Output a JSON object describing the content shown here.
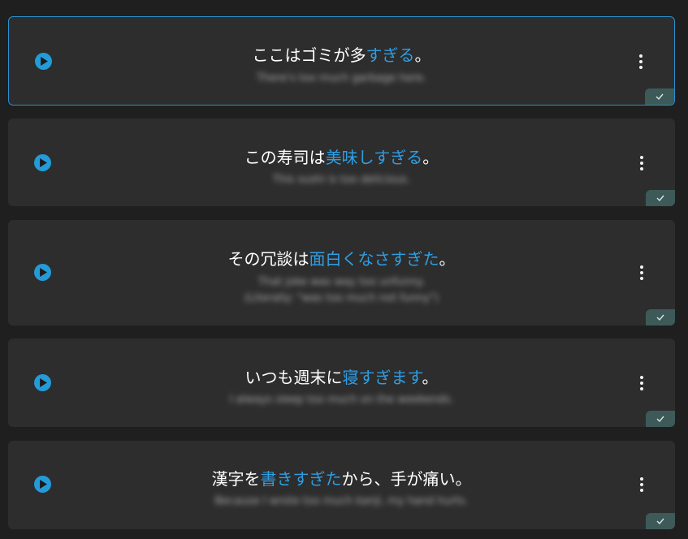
{
  "colors": {
    "accent": "#239bd8",
    "highlight": "#2e9ee3",
    "card": "#2d2d2d",
    "background": "#1f1f1f",
    "badge": "#3d5a59"
  },
  "cards": [
    {
      "parts": [
        "ここはゴミが多",
        "すぎる",
        "。"
      ],
      "translation": "There's too much garbage here.",
      "selected": true
    },
    {
      "parts": [
        "この寿司は",
        "美味しすぎる",
        "。"
      ],
      "translation": "This sushi is too delicious."
    },
    {
      "parts": [
        "その冗談は",
        "面白くなさすぎた",
        "。"
      ],
      "translation_lines": [
        "That joke was way too unfunny.",
        "(Literally: \"was too much not funny\")"
      ]
    },
    {
      "parts": [
        "いつも週末に",
        "寝すぎます",
        "。"
      ],
      "translation": "I always sleep too much on the weekends."
    },
    {
      "parts": [
        "漢字を",
        "書きすぎた",
        "から、手が痛い。"
      ],
      "translation": "Because I wrote too much kanji, my hand hurts."
    }
  ]
}
